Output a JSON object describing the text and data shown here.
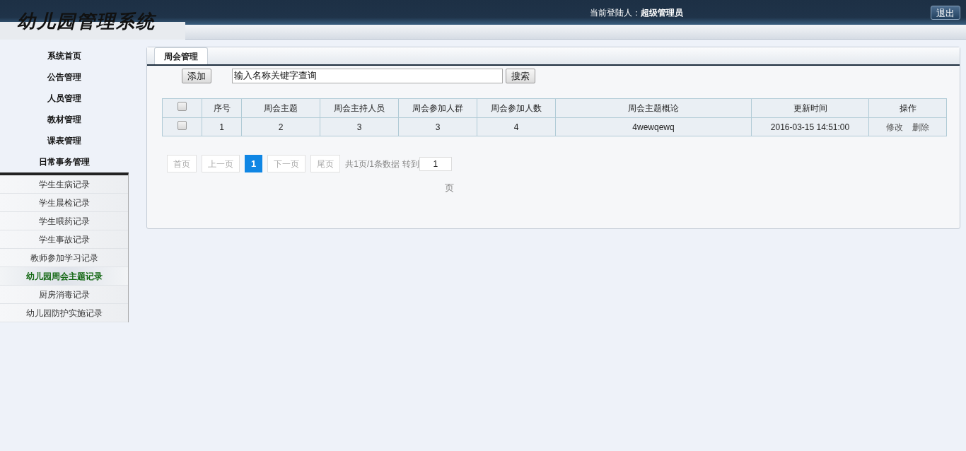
{
  "header": {
    "logo": "幼儿园管理系统",
    "user_label": "当前登陆人：",
    "user_name": "超级管理员",
    "logout": "退出"
  },
  "sidebar": {
    "items": [
      {
        "label": "系统首页"
      },
      {
        "label": "公告管理"
      },
      {
        "label": "人员管理"
      },
      {
        "label": "教材管理"
      },
      {
        "label": "课表管理"
      },
      {
        "label": "日常事务管理",
        "expanded": true,
        "children": [
          {
            "label": "学生生病记录",
            "selected": false
          },
          {
            "label": "学生晨检记录",
            "selected": false
          },
          {
            "label": "学生喂药记录",
            "selected": false
          },
          {
            "label": "学生事故记录",
            "selected": false
          },
          {
            "label": "教师参加学习记录",
            "selected": false
          },
          {
            "label": "幼儿园周会主题记录",
            "selected": true
          },
          {
            "label": "厨房消毒记录",
            "selected": false
          },
          {
            "label": "幼儿园防护实施记录",
            "selected": false
          }
        ]
      }
    ]
  },
  "tabs": [
    {
      "label": "周会管理",
      "selected": true
    }
  ],
  "toolbar": {
    "add": "添加",
    "search_value": "输入名称关键字查询",
    "search": "搜索"
  },
  "table": {
    "header_checked": false,
    "columns": [
      "序号",
      "周会主题",
      "周会主持人员",
      "周会参加人群",
      "周会参加人数",
      "周会主题概论",
      "更新时间",
      "操作"
    ],
    "rows": [
      {
        "checked": false,
        "cells": [
          "1",
          "2",
          "3",
          "3",
          "4",
          "4wewqewq",
          "2016-03-15 14:51:00"
        ],
        "actions": [
          "修改",
          "删除"
        ]
      }
    ]
  },
  "pagination": {
    "items": [
      {
        "label": "首页",
        "kind": "nav",
        "disabled": true
      },
      {
        "label": "上一页",
        "kind": "nav",
        "disabled": true
      },
      {
        "label": "1",
        "kind": "page",
        "selected": true
      },
      {
        "label": "下一页",
        "kind": "nav",
        "disabled": true
      },
      {
        "label": "尾页",
        "kind": "nav",
        "disabled": true
      }
    ],
    "summary": "共1页/1条数据",
    "goto_label": "转到",
    "goto_value": "1",
    "suffix": "页"
  }
}
